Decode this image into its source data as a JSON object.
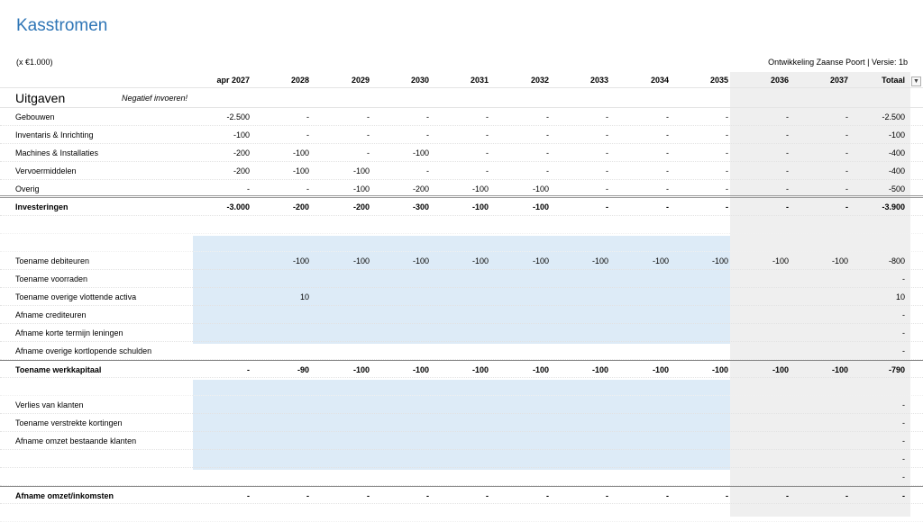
{
  "title": "Kasstromen",
  "unit": "(x €1.000)",
  "project": "Ontwikkeling Zaanse Poort | Versie: 1b",
  "columns": [
    "apr 2027",
    "2028",
    "2029",
    "2030",
    "2031",
    "2032",
    "2033",
    "2034",
    "2035",
    "2036",
    "2037",
    "Totaal"
  ],
  "colors": {
    "title": "#2e75b6",
    "input_fill": "#ddebf7",
    "forecast_fill": "#efefef"
  },
  "icons": {
    "filter": "chevron-down-icon"
  },
  "sections": {
    "uitgaven": {
      "heading": "Uitgaven",
      "note": "Negatief invoeren!",
      "rows": [
        {
          "label": "Gebouwen",
          "values": [
            "-2.500",
            "-",
            "-",
            "-",
            "-",
            "-",
            "-",
            "-",
            "-",
            "-",
            "-",
            "-2.500"
          ]
        },
        {
          "label": "Inventaris & Inrichting",
          "values": [
            "-100",
            "-",
            "-",
            "-",
            "-",
            "-",
            "-",
            "-",
            "-",
            "-",
            "-",
            "-100"
          ]
        },
        {
          "label": "Machines & Installaties",
          "values": [
            "-200",
            "-100",
            "-",
            "-100",
            "-",
            "-",
            "-",
            "-",
            "-",
            "-",
            "-",
            "-400"
          ]
        },
        {
          "label": "Vervoermiddelen",
          "values": [
            "-200",
            "-100",
            "-100",
            "-",
            "-",
            "-",
            "-",
            "-",
            "-",
            "-",
            "-",
            "-400"
          ]
        },
        {
          "label": "Overig",
          "values": [
            "-",
            "-",
            "-100",
            "-200",
            "-100",
            "-100",
            "-",
            "-",
            "-",
            "-",
            "-",
            "-500"
          ]
        }
      ],
      "total": {
        "label": "Investeringen",
        "values": [
          "-3.000",
          "-200",
          "-200",
          "-300",
          "-100",
          "-100",
          "-",
          "-",
          "-",
          "-",
          "-",
          "-3.900"
        ]
      }
    },
    "werkkapitaal": {
      "rows": [
        {
          "label": "Toename debiteuren",
          "values": [
            "",
            "-100",
            "-100",
            "-100",
            "-100",
            "-100",
            "-100",
            "-100",
            "-100",
            "-100",
            "-100",
            "-800"
          ]
        },
        {
          "label": "Toename voorraden",
          "values": [
            "",
            "",
            "",
            "",
            "",
            "",
            "",
            "",
            "",
            "",
            "",
            "-"
          ]
        },
        {
          "label": "Toename overige vlottende activa",
          "values": [
            "",
            "10",
            "",
            "",
            "",
            "",
            "",
            "",
            "",
            "",
            "",
            "10"
          ]
        },
        {
          "label": "Afname crediteuren",
          "values": [
            "",
            "",
            "",
            "",
            "",
            "",
            "",
            "",
            "",
            "",
            "",
            "-"
          ]
        },
        {
          "label": "Afname korte termijn leningen",
          "values": [
            "",
            "",
            "",
            "",
            "",
            "",
            "",
            "",
            "",
            "",
            "",
            "-"
          ]
        },
        {
          "label": "Afname overige kortlopende schulden",
          "values": [
            "",
            "",
            "",
            "",
            "",
            "",
            "",
            "",
            "",
            "",
            "",
            "-"
          ]
        }
      ],
      "total": {
        "label": "Toename werkkapitaal",
        "values": [
          "-",
          "-90",
          "-100",
          "-100",
          "-100",
          "-100",
          "-100",
          "-100",
          "-100",
          "-100",
          "-100",
          "-790"
        ]
      }
    },
    "omzet": {
      "rows": [
        {
          "label": "Verlies van klanten",
          "values": [
            "",
            "",
            "",
            "",
            "",
            "",
            "",
            "",
            "",
            "",
            "",
            "-"
          ]
        },
        {
          "label": "Toename verstrekte kortingen",
          "values": [
            "",
            "",
            "",
            "",
            "",
            "",
            "",
            "",
            "",
            "",
            "",
            "-"
          ]
        },
        {
          "label": "Afname omzet bestaande klanten",
          "values": [
            "",
            "",
            "",
            "",
            "",
            "",
            "",
            "",
            "",
            "",
            "",
            "-"
          ]
        },
        {
          "label": "",
          "values": [
            "",
            "",
            "",
            "",
            "",
            "",
            "",
            "",
            "",
            "",
            "",
            "-"
          ]
        },
        {
          "label": "",
          "values": [
            "",
            "",
            "",
            "",
            "",
            "",
            "",
            "",
            "",
            "",
            "",
            "-"
          ]
        }
      ],
      "total": {
        "label": "Afname omzet/inkomsten",
        "values": [
          "-",
          "-",
          "-",
          "-",
          "-",
          "-",
          "-",
          "-",
          "-",
          "-",
          "-",
          "-"
        ]
      }
    }
  }
}
